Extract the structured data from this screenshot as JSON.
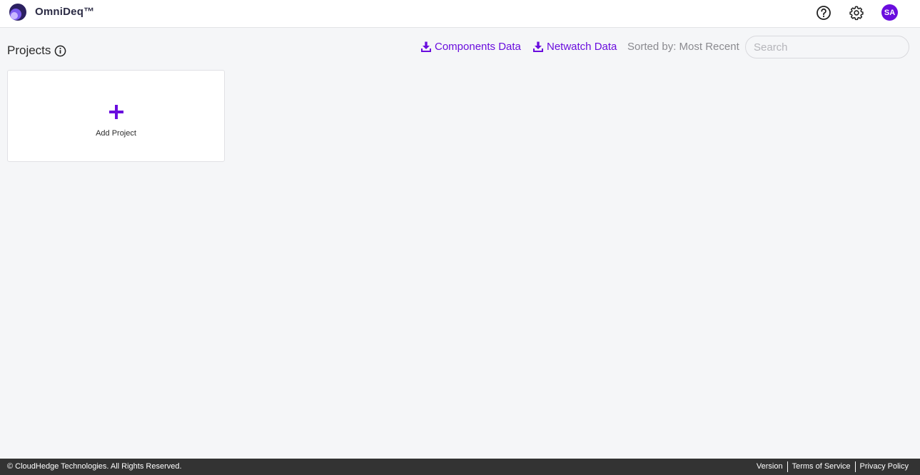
{
  "app": {
    "brand_name": "OmniDeq™",
    "avatar_initials": "SA",
    "accent_color": "#6a0dde"
  },
  "header": {
    "icons": [
      "help-icon",
      "gear-icon"
    ]
  },
  "main": {
    "title": "Projects",
    "title_icon": "info-icon",
    "downloads": [
      {
        "label": "Components Data",
        "icon": "download-icon"
      },
      {
        "label": "Netwatch Data",
        "icon": "download-icon"
      }
    ],
    "sorted_by": "Sorted by: Most Recent",
    "search_placeholder": "Search",
    "add_project_label": "Add Project"
  },
  "footer": {
    "copyright": "© CloudHedge Technologies. All Rights Reserved.",
    "links": [
      "Version",
      "Terms of Service",
      "Privacy Policy"
    ]
  }
}
